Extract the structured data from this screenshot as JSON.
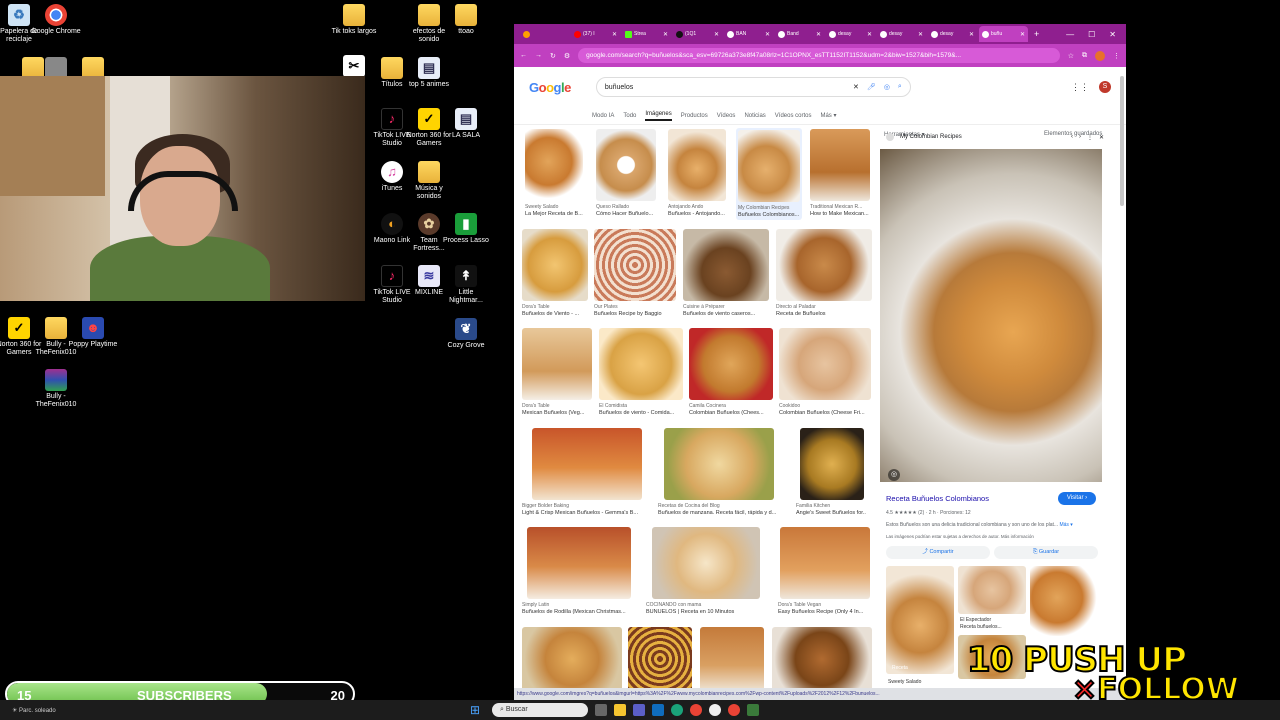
{
  "desktop": {
    "icons": [
      {
        "label": "Papelera de reciclaje",
        "icon": "recycle-bin-icon"
      },
      {
        "label": "Google Chrome",
        "icon": "chrome-icon"
      },
      {
        "label": "Tik toks largos",
        "icon": "folder-icon"
      },
      {
        "label": "efectos de sonido",
        "icon": "folder-icon"
      },
      {
        "label": "ttoao",
        "icon": "folder-icon"
      },
      {
        "label": "Títulos",
        "icon": "folder-icon"
      },
      {
        "label": "top 5 animes",
        "icon": "file-icon"
      },
      {
        "label": "TikTok LIVE Studio",
        "icon": "tiktok-icon"
      },
      {
        "label": "Norton 360 for Gamers",
        "icon": "norton-icon"
      },
      {
        "label": "LA SALA",
        "icon": "file-icon"
      },
      {
        "label": "iTunes",
        "icon": "itunes-icon"
      },
      {
        "label": "Música y sonidos",
        "icon": "folder-icon"
      },
      {
        "label": "Maono Link",
        "icon": "maono-icon"
      },
      {
        "label": "Team Fortress...",
        "icon": "tf2-icon"
      },
      {
        "label": "Process Lasso",
        "icon": "process-lasso-icon"
      },
      {
        "label": "TikTok LIVE Studio",
        "icon": "tiktok-icon"
      },
      {
        "label": "MIXLINE",
        "icon": "mixline-icon"
      },
      {
        "label": "Little Nightmar...",
        "icon": "game-icon"
      },
      {
        "label": "Cozy Grove",
        "icon": "game-icon"
      },
      {
        "label": "Norton 360 for Gamers",
        "icon": "norton-icon"
      },
      {
        "label": "Bully - TheFenix010",
        "icon": "folder-icon"
      },
      {
        "label": "Poppy Playtime",
        "icon": "game-icon"
      },
      {
        "label": "Bully - TheFenix010",
        "icon": "winrar-icon"
      }
    ]
  },
  "browser": {
    "tabs": [
      {
        "label": "(37) I",
        "active": false
      },
      {
        "label": "Strea",
        "active": false
      },
      {
        "label": "(1Q1",
        "active": false
      },
      {
        "label": "BAN",
        "active": false
      },
      {
        "label": "Band",
        "active": false
      },
      {
        "label": "desay",
        "active": false
      },
      {
        "label": "desay",
        "active": false
      },
      {
        "label": "desay",
        "active": false
      },
      {
        "label": "buñu",
        "active": true
      }
    ],
    "url": "google.com/search?q=buñuelos&sca_esv=69726a373e8f47a08rlz=1C1OPNX_esTT1152IT1152&udm=2&biw=1527&bih=1579&...",
    "search_query": "buñuelos",
    "filters": [
      "Modo IA",
      "Todo",
      "Imágenes",
      "Productos",
      "Vídeos",
      "Noticias",
      "Vídeos cortos",
      "Más ▾"
    ],
    "active_filter": "Imágenes",
    "tools_label": "Herramientas ▾",
    "saved_label": "Elementos guardados",
    "results": [
      {
        "src": "Sweety Salado",
        "cap": "La Mejor Receta de B..."
      },
      {
        "src": "Queso Rallado",
        "cap": "Cómo Hacer Buñuelo..."
      },
      {
        "src": "Antojando Ando",
        "cap": "Buñuelos - Antojando..."
      },
      {
        "src": "My Colombian Recipes",
        "cap": "Buñuelos Colombianos..."
      },
      {
        "src": "Traditional Mexican R...",
        "cap": "How to Make Mexican..."
      },
      {
        "src": "Dora's Table",
        "cap": "Buñuelos de Viento - ..."
      },
      {
        "src": "Our Plates",
        "cap": "Buñuelos Recipe by Baggio"
      },
      {
        "src": "Cuisine à Préparer",
        "cap": "Buñuelos de viento caseros..."
      },
      {
        "src": "Directo al Paladar",
        "cap": "Receta de Buñuelos"
      },
      {
        "src": "Dora's Table",
        "cap": "Mexican Buñuelos (Veg..."
      },
      {
        "src": "El Comidista",
        "cap": "Buñuelos de viento - Comida..."
      },
      {
        "src": "Camila Cocinera",
        "cap": "Colombian Buñuelos (Chees..."
      },
      {
        "src": "Cookidoo",
        "cap": "Colombian Buñuelos (Cheese Fri..."
      },
      {
        "src": "Bigger Bolder Baking",
        "cap": "Light & Crisp Mexican Buñuelos - Gemma's B..."
      },
      {
        "src": "Recetas de Cocina del Blog",
        "cap": "Buñuelos de manzana. Receta fácil, rápida y d..."
      },
      {
        "src": "Familia Kitchen",
        "cap": "Angie's Sweet Buñuelos for..."
      },
      {
        "src": "Simply Latin",
        "cap": "Buñuelos de Rodilla (Mexican Christmas..."
      },
      {
        "src": "COCINANDO con mama",
        "cap": "BUÑUELOS | Receta en 10 Minutos"
      },
      {
        "src": "Dora's Table Vegan",
        "cap": "Easy Buñuelos Recipe (Only 4 In..."
      },
      {
        "src": "",
        "cap": ""
      },
      {
        "src": "",
        "cap": ""
      },
      {
        "src": "",
        "cap": ""
      },
      {
        "src": "",
        "cap": ""
      }
    ],
    "panel": {
      "source": "My Colombian Recipes",
      "title": "Receta Buñuelos Colombianos",
      "visit_label": "Visitar ›",
      "rating": "4.5 ★★★★★ (2) · 2 h · Porciones: 12",
      "description": "Estos Buñuelos son una delicia tradicional colombiana y son uno de los plat...",
      "description_more": "Más ▾",
      "note": "Las imágenes podrían estar sujetas a derechos de autor. Más información",
      "share_label": "Compartir",
      "save_label": "Guardar",
      "related_1": "El Espectador",
      "related_1_cap": "Receta buñuelos...",
      "related_2": "Receta",
      "related_3": "Sweety Salado"
    },
    "status_url": "https://www.google.com/imgres?q=buñuelos&imgurl=https%3A%2F%2Fwww.mycolombianrecipes.com%2Fwp-content%2Fuploads%2F2012%2F12%2Fbunuelos..."
  },
  "overlay": {
    "sub_start": "15",
    "sub_label": "SUBSCRIBERS",
    "sub_goal": "20",
    "sub_progress": 0.75,
    "promo_line1": "10 PUSH UP",
    "promo_x": "×",
    "promo_line2": "FOLLOW"
  },
  "taskbar": {
    "left_text": "Parc. soleado",
    "search_label": "Buscar",
    "clock_time": "",
    "clock_date": ""
  }
}
